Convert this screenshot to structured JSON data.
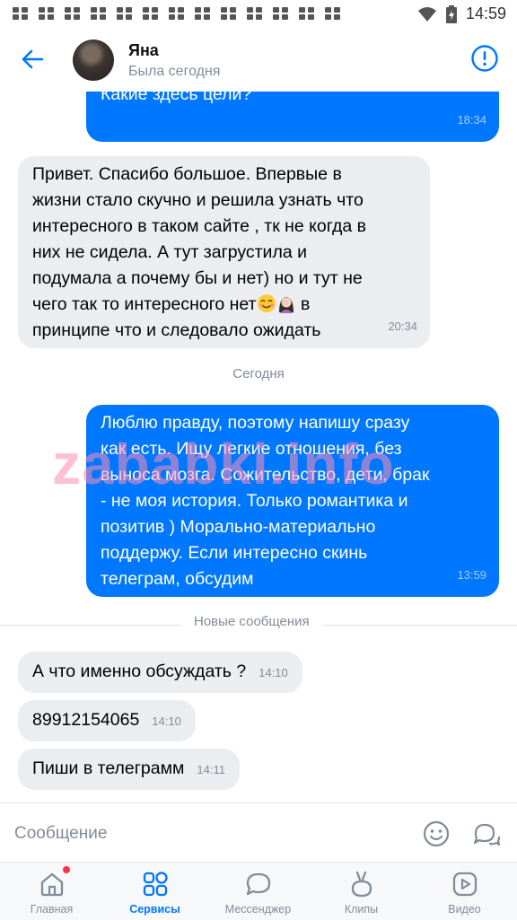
{
  "status_bar": {
    "time": "14:59",
    "icons": [
      "notification-icon",
      "notification-icon",
      "notification-icon",
      "notification-icon",
      "notification-icon",
      "notification-icon",
      "notification-icon",
      "notification-icon",
      "notification-icon",
      "notification-icon",
      "notification-icon",
      "notification-icon",
      "notification-icon",
      "wifi-icon",
      "battery-charging-icon"
    ]
  },
  "header": {
    "name": "Яна",
    "status": "Была сегодня",
    "back_icon": "arrow-left-icon",
    "report_icon": "exclamation-circle-icon"
  },
  "messages": [
    {
      "direction": "out",
      "text": "Добрый вечер. Хорошо выглядишь )\nКакие здесь цели?",
      "time": "18:34"
    },
    {
      "direction": "in",
      "text_before_emoji": "Привет. Спасибо большое. Впервые в\nжизни стало скучно и решила узнать что\nинтересного в таком сайте , тк не когда в\nних не сидела. А тут загрустила и\nподумала а почему бы и нет) но и тут не\nчего так то интересного нет",
      "emoji": [
        "smiling-face-icon",
        "woman-facepalming-icon"
      ],
      "text_after_emoji": " в\nпринципе что и следовало ожидать",
      "time": "20:34"
    },
    {
      "direction": "out",
      "text": "Люблю правду, поэтому напишу сразу\nкак есть. Ищу легкие отношения, без\nвыноса мозга. Сожительство, дети, брак\n- не моя история. Только романтика и\nпозитив ) Морально-материально\nподдержу. Если интересно скинь\nтелеграм, обсудим",
      "time": "13:59"
    },
    {
      "direction": "in",
      "text": "А что именно обсуждать ?",
      "time": "14:10"
    },
    {
      "direction": "in",
      "text": "89912154065",
      "time": "14:10"
    },
    {
      "direction": "in",
      "text": "Пиши в телеграмм",
      "time": "14:11"
    }
  ],
  "dividers": {
    "today": "Сегодня",
    "new_messages": "Новые сообщения"
  },
  "watermark": "zababki.info",
  "composer": {
    "placeholder": "Сообщение",
    "emoji_icon": "smile-icon",
    "voice_icon": "chat-bubbles-icon"
  },
  "tabbar": {
    "tabs": [
      {
        "label": "Главная",
        "icon": "home-icon",
        "badge": true
      },
      {
        "label": "Сервисы",
        "icon": "services-grid-icon",
        "active": true
      },
      {
        "label": "Мессенджер",
        "icon": "message-bubble-icon"
      },
      {
        "label": "Клипы",
        "icon": "clips-icon"
      },
      {
        "label": "Видео",
        "icon": "video-play-icon"
      }
    ]
  },
  "colors": {
    "accent": "#0077ff",
    "outgoing_bubble": "#0077ff",
    "incoming_bubble": "#ebedf0",
    "secondary_text": "#818c99",
    "badge": "#ff3347"
  }
}
